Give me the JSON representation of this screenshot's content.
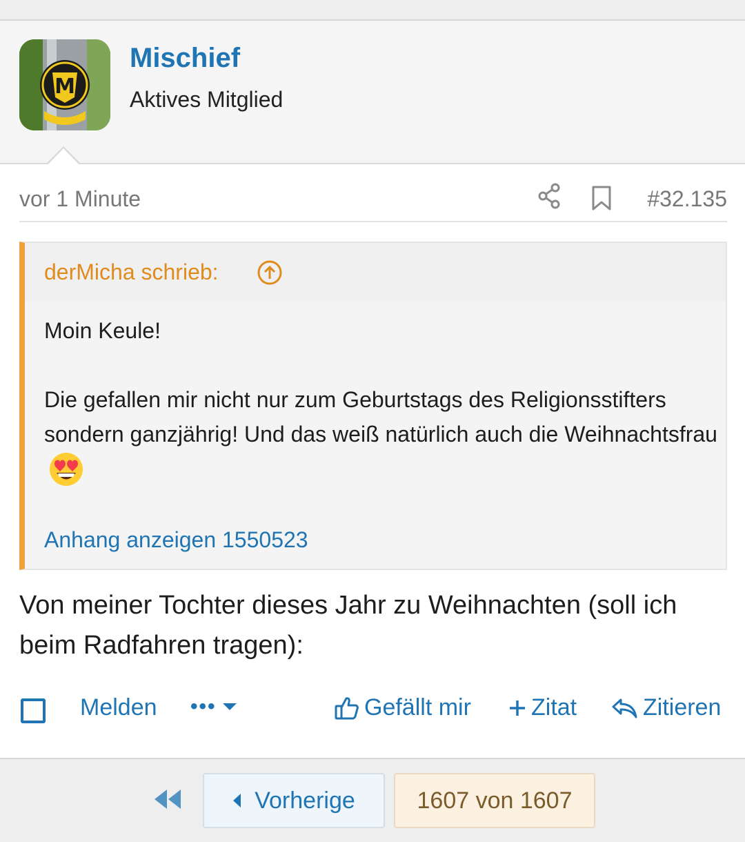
{
  "post": {
    "username": "Mischief",
    "user_title": "Aktives Mitglied",
    "avatar_icon": "marschall-headbadge-avatar",
    "time": "vor 1 Minute",
    "number": "#32.135",
    "share_icon": "share-icon",
    "bookmark_icon": "bookmark-icon",
    "quote": {
      "author_line": "derMicha schrieb:",
      "paragraph1": "Moin Keule!",
      "paragraph2": "Die gefallen mir nicht nur zum Geburtstags des Religionsstifters sondern ganzjährig! Und das weiß natürlich auch die Weihnachtsfrau",
      "emoji": "heart-eyes-emoji",
      "attachment_link": "Anhang anzeigen 1550523"
    },
    "text": "Von meiner Tochter dieses Jahr zu Weihnachten (soll ich beim Radfahren tragen):"
  },
  "actions": {
    "report_label": "Melden",
    "more_label": "•••",
    "like_label": "Gefällt mir",
    "multiquote_label": "Zitat",
    "reply_label": "Zitieren"
  },
  "pagination": {
    "previous_label": "Vorherige",
    "page_label": "1607 von 1607"
  },
  "colors": {
    "link": "#1f74b3",
    "quote_accent": "#f0a23a",
    "quote_author": "#e08b1e"
  }
}
